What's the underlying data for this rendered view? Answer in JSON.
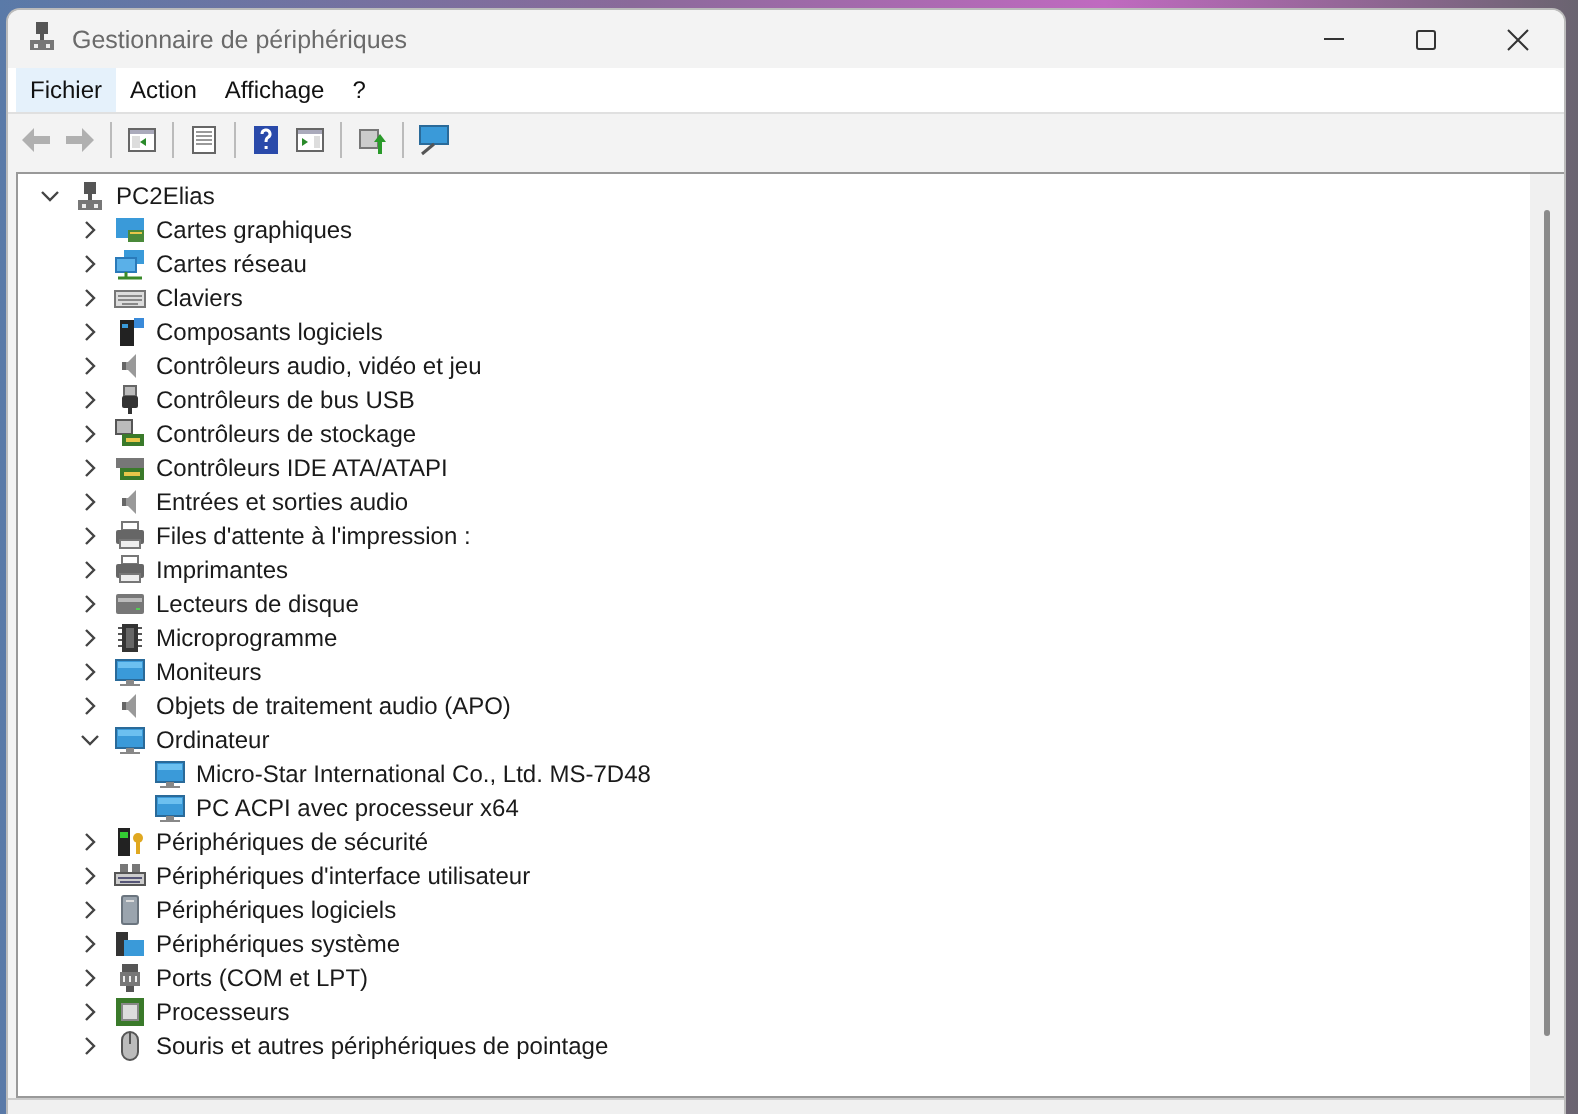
{
  "window": {
    "title": "Gestionnaire de périphériques"
  },
  "menu": [
    {
      "label": "Fichier",
      "selected": true
    },
    {
      "label": "Action",
      "selected": false
    },
    {
      "label": "Affichage",
      "selected": false
    },
    {
      "label": "?",
      "selected": false
    }
  ],
  "toolbar": [
    {
      "kind": "back",
      "disabled": true
    },
    {
      "kind": "forward",
      "disabled": true
    },
    {
      "kind": "sep"
    },
    {
      "kind": "tree",
      "disabled": false
    },
    {
      "kind": "sep"
    },
    {
      "kind": "properties",
      "disabled": false
    },
    {
      "kind": "sep"
    },
    {
      "kind": "help",
      "disabled": false
    },
    {
      "kind": "pane",
      "disabled": false
    },
    {
      "kind": "sep"
    },
    {
      "kind": "update",
      "disabled": false
    },
    {
      "kind": "sep"
    },
    {
      "kind": "scan",
      "disabled": false
    }
  ],
  "tree": {
    "label": "PC2Elias",
    "kind": "computer",
    "expanded": true,
    "children": [
      {
        "label": "Cartes graphiques",
        "kind": "display",
        "expanded": false
      },
      {
        "label": "Cartes réseau",
        "kind": "network",
        "expanded": false
      },
      {
        "label": "Claviers",
        "kind": "keyboard",
        "expanded": false
      },
      {
        "label": "Composants logiciels",
        "kind": "component",
        "expanded": false
      },
      {
        "label": "Contrôleurs audio, vidéo et jeu",
        "kind": "speaker",
        "expanded": false
      },
      {
        "label": "Contrôleurs de bus USB",
        "kind": "usb",
        "expanded": false
      },
      {
        "label": "Contrôleurs de stockage",
        "kind": "storage",
        "expanded": false
      },
      {
        "label": "Contrôleurs IDE ATA/ATAPI",
        "kind": "ide",
        "expanded": false
      },
      {
        "label": "Entrées et sorties audio",
        "kind": "speaker",
        "expanded": false
      },
      {
        "label": "Files d'attente à l'impression :",
        "kind": "printer",
        "expanded": false
      },
      {
        "label": "Imprimantes",
        "kind": "printer",
        "expanded": false
      },
      {
        "label": "Lecteurs de disque",
        "kind": "disk",
        "expanded": false
      },
      {
        "label": "Microprogramme",
        "kind": "firmware",
        "expanded": false
      },
      {
        "label": "Moniteurs",
        "kind": "monitor",
        "expanded": false
      },
      {
        "label": "Objets de traitement audio (APO)",
        "kind": "speaker",
        "expanded": false
      },
      {
        "label": "Ordinateur",
        "kind": "monitor",
        "expanded": true,
        "children": [
          {
            "label": "Micro-Star International Co., Ltd. MS-7D48",
            "kind": "monitor"
          },
          {
            "label": "PC ACPI avec processeur x64",
            "kind": "monitor"
          }
        ]
      },
      {
        "label": "Périphériques de sécurité",
        "kind": "security",
        "expanded": false
      },
      {
        "label": "Périphériques d'interface utilisateur",
        "kind": "hid",
        "expanded": false
      },
      {
        "label": "Périphériques logiciels",
        "kind": "software",
        "expanded": false
      },
      {
        "label": "Périphériques système",
        "kind": "system",
        "expanded": false
      },
      {
        "label": "Ports (COM et LPT)",
        "kind": "port",
        "expanded": false
      },
      {
        "label": "Processeurs",
        "kind": "cpu",
        "expanded": false
      },
      {
        "label": "Souris et autres périphériques de pointage",
        "kind": "mouse",
        "expanded": false
      }
    ]
  }
}
